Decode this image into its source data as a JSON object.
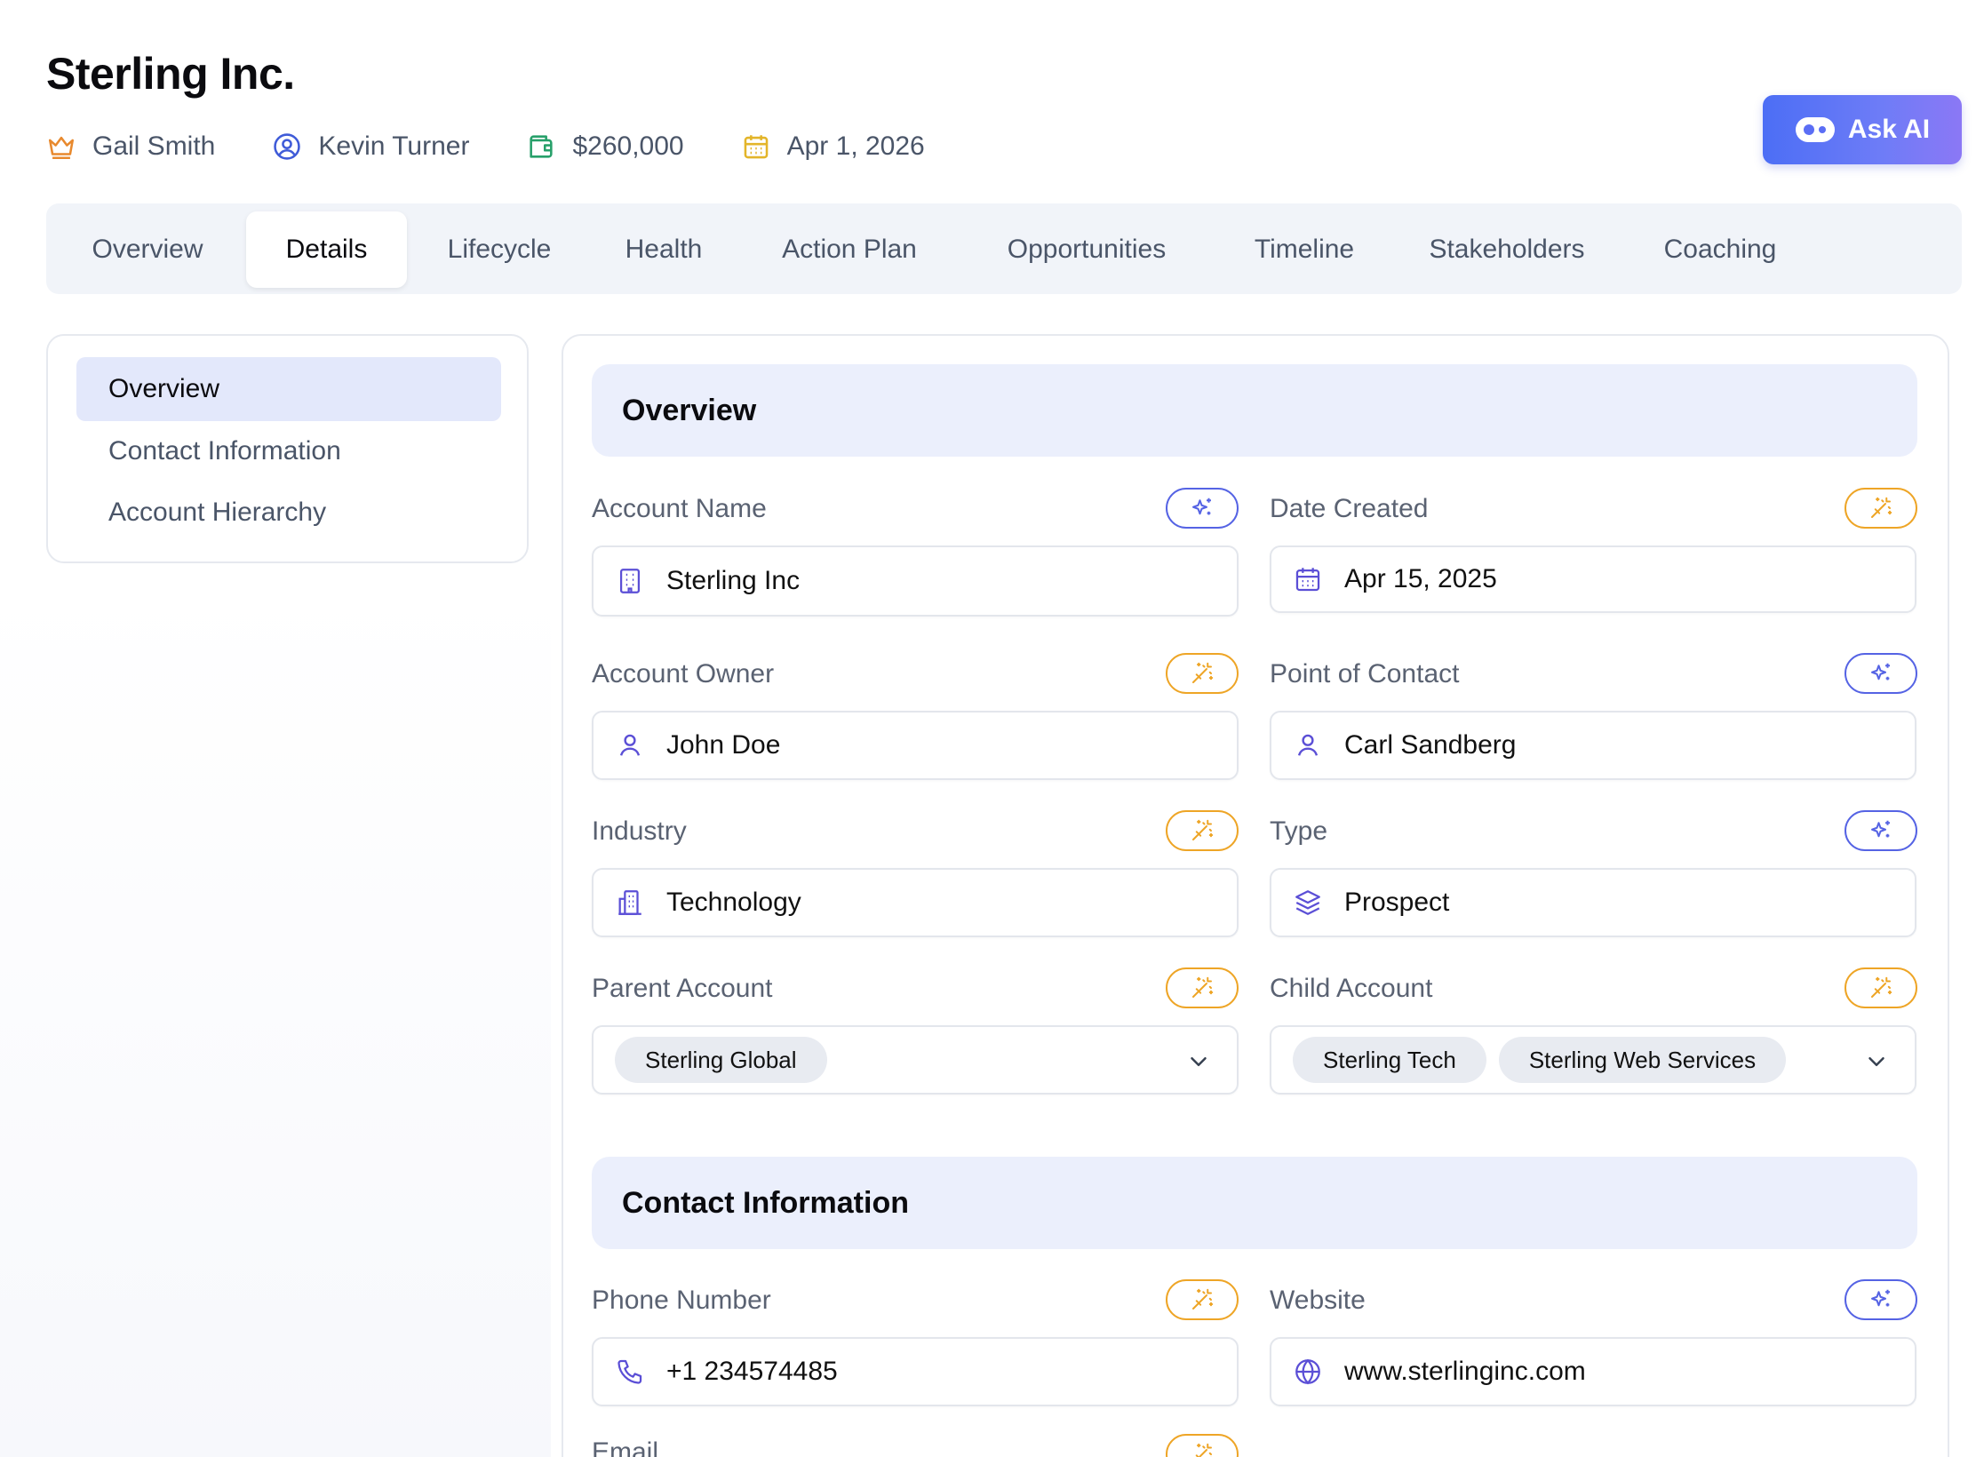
{
  "header": {
    "title": "Sterling Inc.",
    "meta": [
      {
        "icon": "crown-icon",
        "label": "Gail Smith",
        "color": "#e8892d"
      },
      {
        "icon": "user-circle-icon",
        "label": "Kevin Turner",
        "color": "#3f5bd8"
      },
      {
        "icon": "wallet-icon",
        "label": "$260,000",
        "color": "#27a06a"
      },
      {
        "icon": "calendar-icon",
        "label": "Apr 1, 2026",
        "color": "#e3b52a"
      }
    ],
    "ask_ai_label": "Ask AI"
  },
  "tabs": [
    {
      "label": "Overview",
      "active": false
    },
    {
      "label": "Details",
      "active": true
    },
    {
      "label": "Lifecycle",
      "active": false
    },
    {
      "label": "Health",
      "active": false
    },
    {
      "label": "Action Plan",
      "active": false
    },
    {
      "label": "Opportunities",
      "active": false
    },
    {
      "label": "Timeline",
      "active": false
    },
    {
      "label": "Stakeholders",
      "active": false
    },
    {
      "label": "Coaching",
      "active": false
    }
  ],
  "side_nav": [
    {
      "label": "Overview",
      "active": true
    },
    {
      "label": "Contact Information",
      "active": false
    },
    {
      "label": "Account Hierarchy",
      "active": false
    }
  ],
  "sections": {
    "overview": {
      "title": "Overview",
      "fields": {
        "account_name": {
          "label": "Account Name",
          "value": "Sterling Inc",
          "icon": "building-icon",
          "ai": "sparkle"
        },
        "date_created": {
          "label": "Date Created",
          "value": "Apr 15, 2025",
          "icon": "calendar-icon",
          "ai": "wand"
        },
        "account_owner": {
          "label": "Account Owner",
          "value": "John Doe",
          "icon": "user-icon",
          "ai": "wand"
        },
        "point_of_contact": {
          "label": "Point of Contact",
          "value": "Carl Sandberg",
          "icon": "user-icon",
          "ai": "sparkle"
        },
        "industry": {
          "label": "Industry",
          "value": "Technology",
          "icon": "office-building-icon",
          "ai": "wand"
        },
        "type": {
          "label": "Type",
          "value": "Prospect",
          "icon": "layers-icon",
          "ai": "sparkle"
        },
        "parent_account": {
          "label": "Parent Account",
          "chips": [
            "Sterling Global"
          ],
          "ai": "wand"
        },
        "child_account": {
          "label": "Child Account",
          "chips": [
            "Sterling Tech",
            "Sterling Web Services"
          ],
          "ai": "wand"
        }
      }
    },
    "contact": {
      "title": "Contact Information",
      "fields": {
        "phone": {
          "label": "Phone Number",
          "value": "+1 234574485",
          "icon": "phone-icon",
          "ai": "wand"
        },
        "website": {
          "label": "Website",
          "value": "www.sterlinginc.com",
          "icon": "globe-icon",
          "ai": "sparkle"
        },
        "email": {
          "label": "Email",
          "ai": "wand"
        }
      }
    }
  },
  "colors": {
    "accent": "#4c6ef5",
    "sparkle": "#5563e4",
    "wand": "#eea526",
    "field_icon": "#5b4fd6"
  }
}
